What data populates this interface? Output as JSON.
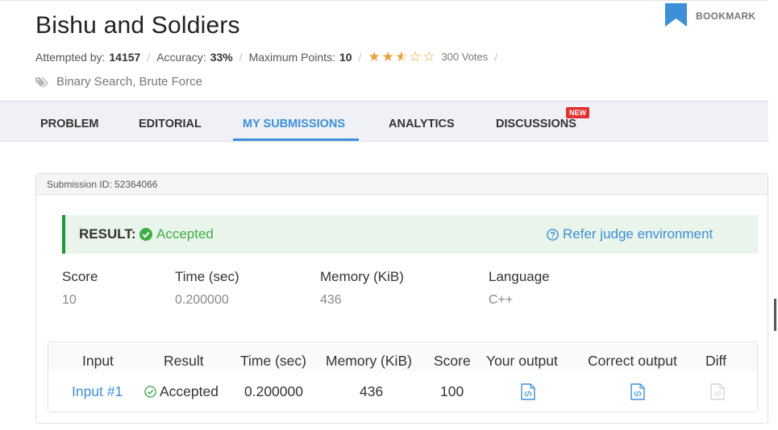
{
  "problem": {
    "title": "Bishu and Soldiers",
    "attempted_label": "Attempted by:",
    "attempted_value": "14157",
    "accuracy_label": "Accuracy:",
    "accuracy_value": "33%",
    "max_points_label": "Maximum Points:",
    "max_points_value": "10",
    "rating": 2.5,
    "rating_max": 5,
    "votes": "300 Votes",
    "tags": "Binary Search, Brute Force",
    "bookmark_label": "BOOKMARK",
    "star_color": "#e8a23b",
    "bookmark_color": "#3d8fd8"
  },
  "tabs": [
    {
      "label": "PROBLEM",
      "active": false
    },
    {
      "label": "EDITORIAL",
      "active": false
    },
    {
      "label": "MY SUBMISSIONS",
      "active": true
    },
    {
      "label": "ANALYTICS",
      "active": false
    },
    {
      "label": "DISCUSSIONS",
      "active": false,
      "badge": "NEW"
    }
  ],
  "submission": {
    "id_label": "Submission ID: 52364066",
    "result_label": "RESULT:",
    "result_value": "Accepted",
    "refer_label": "Refer judge environment",
    "stats": [
      {
        "label": "Score",
        "value": "10"
      },
      {
        "label": "Time (sec)",
        "value": "0.200000"
      },
      {
        "label": "Memory (KiB)",
        "value": "436"
      },
      {
        "label": "Language",
        "value": "C++"
      }
    ],
    "accent_green": "#1f9a35",
    "accent_blue": "#3d8fd8"
  },
  "results_table": {
    "headers": [
      "Input",
      "Result",
      "Time (sec)",
      "Memory (KiB)",
      "Score",
      "Your output",
      "Correct output",
      "Diff"
    ],
    "rows": [
      {
        "input": "Input #1",
        "result": "Accepted",
        "time": "0.200000",
        "memory": "436",
        "score": "100",
        "your_output_icon": "code-file-icon",
        "correct_output_icon": "code-file-icon",
        "diff_icon": "code-file-icon"
      }
    ]
  }
}
